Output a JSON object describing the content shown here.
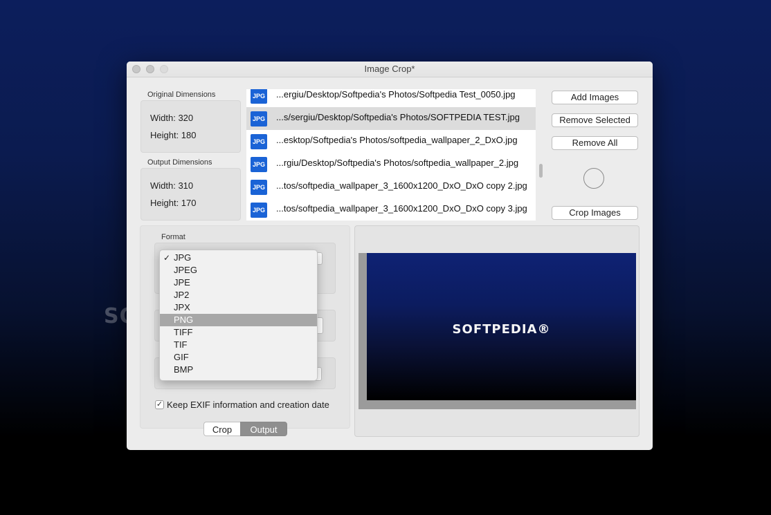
{
  "watermark": "SOFTPEDIA",
  "window": {
    "title": "Image Crop*"
  },
  "original_dimensions": {
    "label": "Original Dimensions",
    "width": "Width: 320",
    "height": "Height: 180"
  },
  "output_dimensions": {
    "label": "Output Dimensions",
    "width": "Width: 310",
    "height": "Height: 170"
  },
  "files": [
    {
      "icon": "JPG",
      "name": "...ergiu/Desktop/Softpedia's Photos/Softpedia Test_0050.jpg",
      "selected": false
    },
    {
      "icon": "JPG",
      "name": "...s/sergiu/Desktop/Softpedia's Photos/SOFTPEDIA TEST.jpg",
      "selected": true
    },
    {
      "icon": "JPG",
      "name": "...esktop/Softpedia's Photos/softpedia_wallpaper_2_DxO.jpg",
      "selected": false
    },
    {
      "icon": "JPG",
      "name": "...rgiu/Desktop/Softpedia's Photos/softpedia_wallpaper_2.jpg",
      "selected": false
    },
    {
      "icon": "JPG",
      "name": "...tos/softpedia_wallpaper_3_1600x1200_DxO_DxO copy 2.jpg",
      "selected": false
    },
    {
      "icon": "JPG",
      "name": "...tos/softpedia_wallpaper_3_1600x1200_DxO_DxO copy 3.jpg",
      "selected": false
    }
  ],
  "buttons": {
    "add_images": "Add Images",
    "remove_selected": "Remove Selected",
    "remove_all": "Remove All",
    "crop_images": "Crop Images"
  },
  "format": {
    "label": "Format",
    "selected": "JPG",
    "highlighted": "PNG",
    "options": [
      "JPG",
      "JPEG",
      "JPE",
      "JP2",
      "JPX",
      "PNG",
      "TIFF",
      "TIF",
      "GIF",
      "BMP"
    ]
  },
  "exif_checkbox": {
    "label": "Keep EXIF information and creation date",
    "checked": true,
    "mark": "✓"
  },
  "segmented": {
    "crop": "Crop",
    "output": "Output",
    "active": "Output"
  },
  "preview": {
    "logo_text": "SOFTPEDIA®"
  },
  "colors": {
    "file_icon": "#1a63d6",
    "menu_highlight": "#a7a7a7",
    "segment_active": "#8f8f8f"
  }
}
